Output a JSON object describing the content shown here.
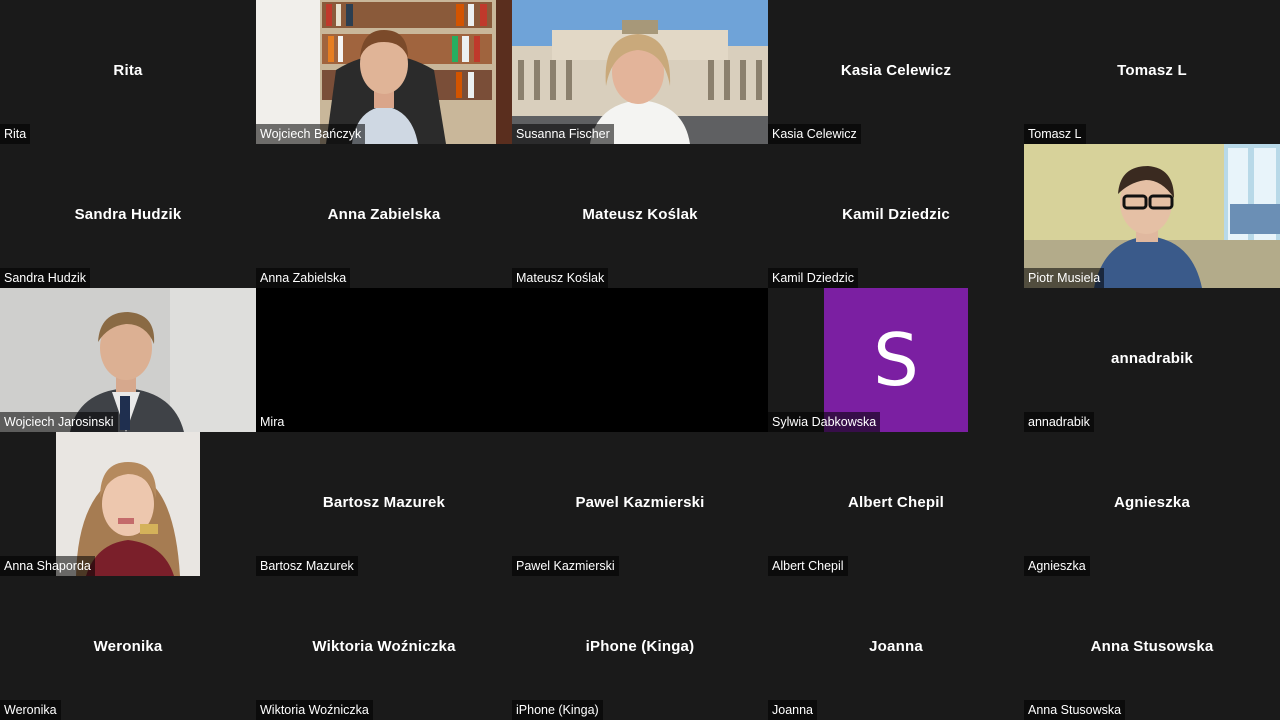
{
  "colors": {
    "background": "#1a1a1a",
    "tile_black": "#000000",
    "avatar_purple": "#7b1fa2",
    "label_bg": "rgba(0,0,0,0.55)"
  },
  "participants": [
    {
      "name": "Rita",
      "label": "Rita",
      "video": false
    },
    {
      "name": "Wojciech Bańczyk",
      "label": "Wojciech Bańczyk",
      "video": true
    },
    {
      "name": "Susanna Fischer",
      "label": "Susanna Fischer",
      "video": true
    },
    {
      "name": "Kasia Celewicz",
      "label": "Kasia Celewicz",
      "video": false
    },
    {
      "name": "Tomasz L",
      "label": "Tomasz L",
      "video": false
    },
    {
      "name": "Sandra Hudzik",
      "label": "Sandra Hudzik",
      "video": false
    },
    {
      "name": "Anna Zabielska",
      "label": "Anna Zabielska",
      "video": false
    },
    {
      "name": "Mateusz Koślak",
      "label": "Mateusz Koślak",
      "video": false
    },
    {
      "name": "Kamil Dziedzic",
      "label": "Kamil Dziedzic",
      "video": false
    },
    {
      "name": "Piotr Musiela",
      "label": "Piotr Musiela",
      "video": true
    },
    {
      "name": "Wojciech Jarosinski",
      "label": "Wojciech Jarosinski",
      "video": true
    },
    {
      "name": "Mira",
      "label": "Mira",
      "video": "black"
    },
    {
      "name": "",
      "label": "",
      "video": "black"
    },
    {
      "name": "Sylwia Dabkowska",
      "label": "Sylwia Dabkowska",
      "video": "avatar",
      "avatar_letter": "S"
    },
    {
      "name": "annadrabik",
      "label": "annadrabik",
      "video": false
    },
    {
      "name": "Anna Shaporda",
      "label": "Anna Shaporda",
      "video": true
    },
    {
      "name": "Bartosz Mazurek",
      "label": "Bartosz Mazurek",
      "video": false
    },
    {
      "name": "Pawel Kazmierski",
      "label": "Pawel Kazmierski",
      "video": false
    },
    {
      "name": "Albert Chepil",
      "label": "Albert Chepil",
      "video": false
    },
    {
      "name": "Agnieszka",
      "label": "Agnieszka",
      "video": false
    },
    {
      "name": "Weronika",
      "label": "Weronika",
      "video": false
    },
    {
      "name": "Wiktoria Woźniczka",
      "label": "Wiktoria Woźniczka",
      "video": false
    },
    {
      "name": "iPhone (Kinga)",
      "label": "iPhone (Kinga)",
      "video": false
    },
    {
      "name": "Joanna",
      "label": "Joanna",
      "video": false
    },
    {
      "name": "Anna Stusowska",
      "label": "Anna Stusowska",
      "video": false
    }
  ]
}
